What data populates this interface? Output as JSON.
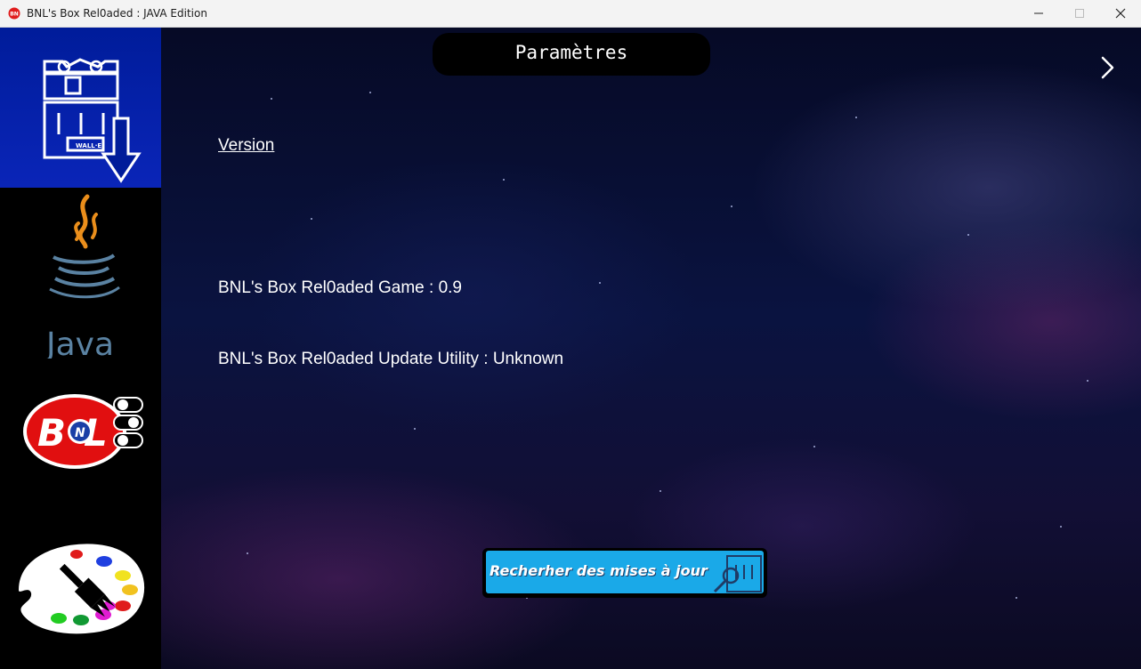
{
  "window": {
    "title": "BNL's Box Rel0aded : JAVA Edition",
    "icons": [
      "app-icon",
      "minimize-icon",
      "maximize-icon",
      "close-icon"
    ]
  },
  "sidebar": {
    "items": [
      {
        "name": "wall-e-updater",
        "icon": "wall-e-download-icon",
        "active": true
      },
      {
        "name": "java",
        "icon": "java-logo-icon",
        "active": false
      },
      {
        "name": "bnl",
        "icon": "bnl-logo-icon",
        "active": false
      },
      {
        "name": "themes",
        "icon": "palette-icon",
        "active": false
      }
    ],
    "active_color": "#001c9a"
  },
  "main": {
    "title": "Paramètres",
    "version_link": "Version",
    "game_version_line": "BNL's Box Rel0aded Game : 0.9",
    "updater_version_line": "BNL's Box Rel0aded Update Utility : Unknown",
    "update_button_label": "Recherher des mises à jour",
    "next_icon": "chevron-right-icon"
  },
  "colors": {
    "update_button": "#1aa9e8",
    "background_deep": "#0a1340"
  }
}
